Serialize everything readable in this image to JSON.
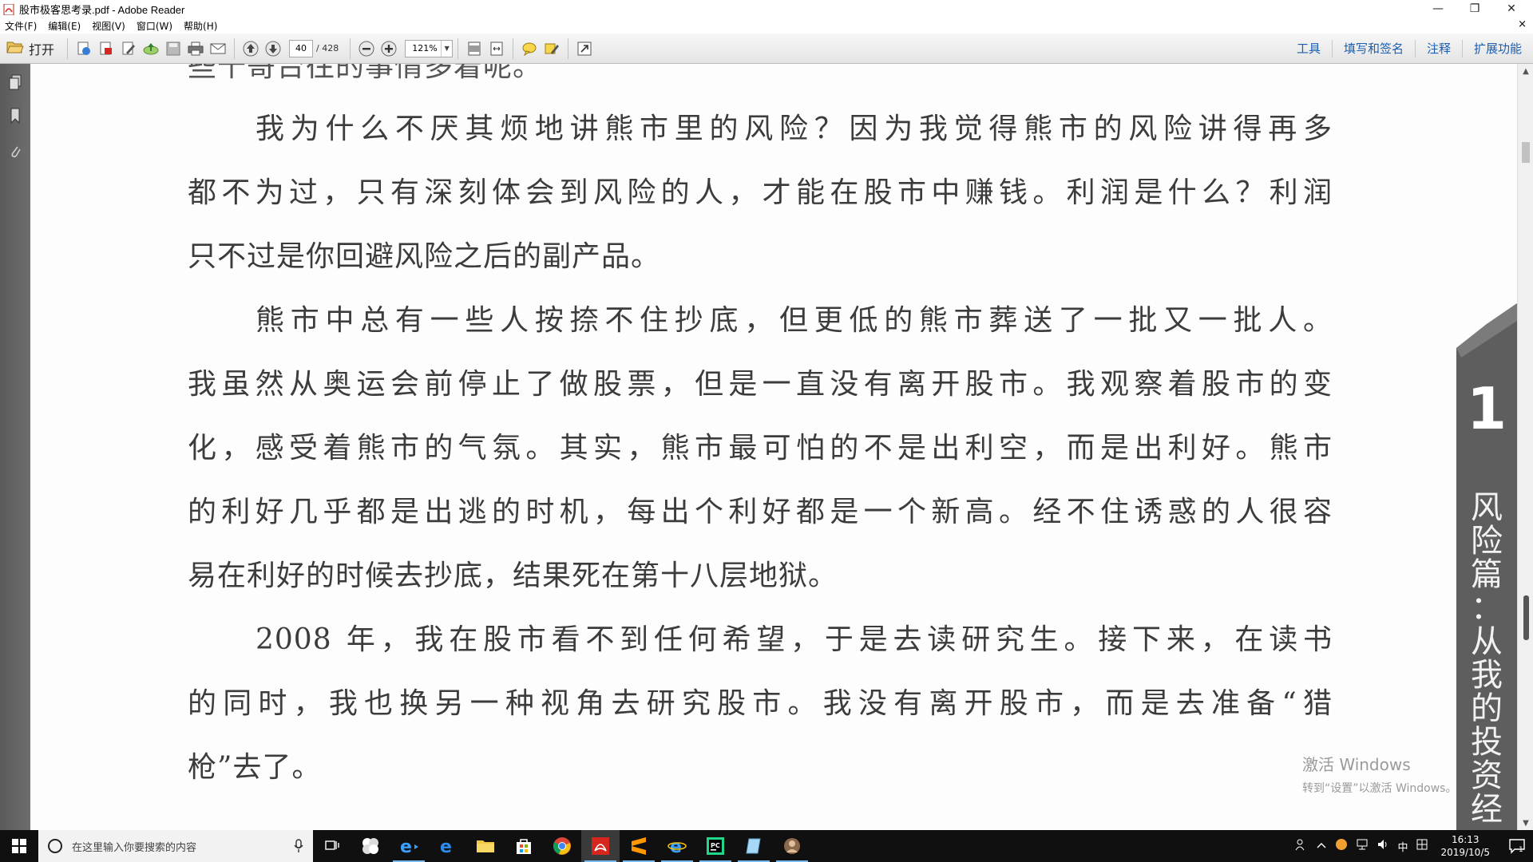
{
  "window": {
    "title": "股市极客思考录.pdf - Adobe Reader",
    "controls": {
      "minimize": "—",
      "restore": "❐",
      "close": "✕"
    }
  },
  "menu": {
    "items": [
      "文件(F)",
      "编辑(E)",
      "视图(V)",
      "窗口(W)",
      "帮助(H)"
    ],
    "doc_close": "×"
  },
  "toolbar": {
    "open_label": "打开",
    "current_page": "40",
    "total_pages": "/ 428",
    "zoom": "121%",
    "right_links": [
      "工具",
      "填写和签名",
      "注释",
      "扩展功能"
    ]
  },
  "document": {
    "cut_line": "些十哥台往的事情多着呢。",
    "lines": [
      "我为什么不厌其烦地讲熊市里的风险？因为我觉得熊市的风险讲得再多",
      "都不为过，只有深刻体会到风险的人，才能在股市中赚钱。利润是什么？利润",
      "只不过是你回避风险之后的副产品。",
      "熊市中总有一些人按捺不住抄底，但更低的熊市葬送了一批又一批人。",
      "我虽然从奥运会前停止了做股票，但是一直没有离开股市。我观察着股市的变",
      "化，感受着熊市的气氛。其实，熊市最可怕的不是出利空，而是出利好。熊市",
      "的利好几乎都是出逃的时机，每出个利好都是一个新高。经不住诱惑的人很容",
      "易在利好的时候去抄底，结果死在第十八层地狱。",
      "2008 年，我在股市看不到任何希望，于是去读研究生。接下来，在读书",
      "的同时，我也换另一种视角去研究股市。我没有离开股市，而是去准备“猎",
      "枪”去了。"
    ],
    "chapter_number": "1",
    "chapter_title": [
      "风",
      "险",
      "篇",
      "：",
      "从",
      "我",
      "的",
      "投",
      "资",
      "经"
    ]
  },
  "watermark": {
    "line1": "激活 Windows",
    "line2": "转到“设置”以激活 Windows。"
  },
  "taskbar": {
    "search_placeholder": "在这里输入你要搜索的内容",
    "tray": {
      "ime": "中",
      "time": "16:13",
      "date": "2019/10/5",
      "notifications": "1"
    }
  }
}
